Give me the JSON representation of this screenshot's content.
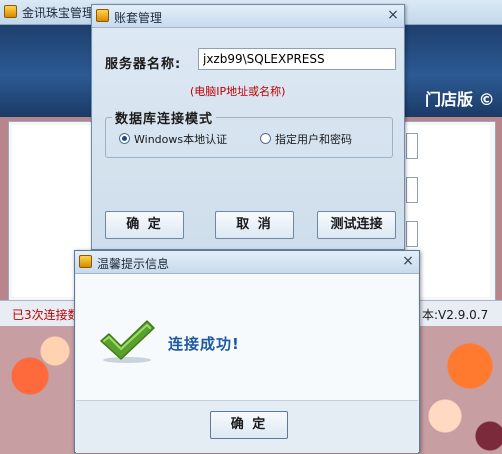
{
  "background_window": {
    "title": "金讯珠宝管理",
    "brand": "门店版 ©",
    "status": "已3次连接数",
    "version": "本:V2.9.0.7"
  },
  "account_window": {
    "title": "账套管理",
    "server_label": "服务器名称:",
    "server_value": "jxzb99\\SQLEXPRESS",
    "server_hint": "(电脑IP地址或名称)",
    "mode_title": "数据库连接模式",
    "mode_options": [
      {
        "label": "Windows本地认证",
        "selected": true
      },
      {
        "label": "指定用户和密码",
        "selected": false
      }
    ],
    "ok_button": "确 定",
    "cancel_button": "取 消",
    "test_button": "测试连接",
    "close_symbol": "×"
  },
  "message_dialog": {
    "title": "温馨提示信息",
    "message": "连接成功!",
    "ok_button": "确 定",
    "close_symbol": "×",
    "icon": "check-icon"
  },
  "colors": {
    "accent_blue": "#1f5aa0",
    "error_red": "#c00000",
    "check_green": "#5aa02c"
  }
}
